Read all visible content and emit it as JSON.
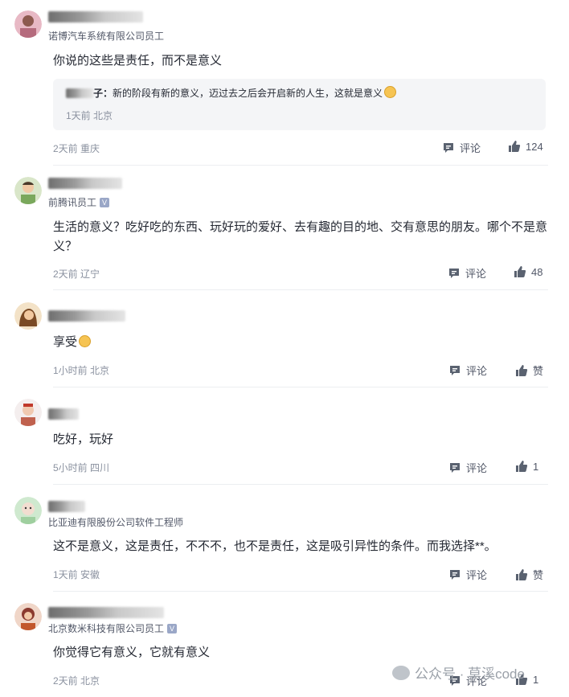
{
  "comments": [
    {
      "company": "诺博汽车系统有限公司员工",
      "verified": false,
      "text": "你说的这些是责任，而不是意义",
      "reply": {
        "author_fragment": "子：",
        "text": "新的阶段有新的意义，迈过去之后会开启新的人生，这就是意义",
        "meta": "1天前 北京"
      },
      "meta": "2天前 重庆",
      "reply_label": "评论",
      "like_label": "124"
    },
    {
      "company": "前腾讯员工",
      "verified": true,
      "text": "生活的意义？吃好吃的东西、玩好玩的爱好、去有趣的目的地、交有意思的朋友。哪个不是意义？",
      "meta": "2天前 辽宁",
      "reply_label": "评论",
      "like_label": "48"
    },
    {
      "company": "",
      "verified": false,
      "text": "享受",
      "meta": "1小时前 北京",
      "reply_label": "评论",
      "like_label": "赞"
    },
    {
      "company": "",
      "verified": false,
      "text": "吃好，玩好",
      "meta": "5小时前 四川",
      "reply_label": "评论",
      "like_label": "1"
    },
    {
      "company": "比亚迪有限股份公司软件工程师",
      "verified": false,
      "text": "这不是意义，这是责任，不不不，也不是责任，这是吸引异性的条件。而我选择**。",
      "meta": "1天前 安徽",
      "reply_label": "评论",
      "like_label": "赞"
    },
    {
      "company": "北京数米科技有限公司员工",
      "verified": true,
      "text": "你觉得它有意义，它就有意义",
      "meta": "2天前 北京",
      "reply_label": "评论",
      "like_label": "1"
    }
  ],
  "watermark": "公众号 · 莫溪code",
  "colors": {
    "meta": "#8a919f",
    "text": "#252933",
    "quote_bg": "#f4f5f7"
  }
}
